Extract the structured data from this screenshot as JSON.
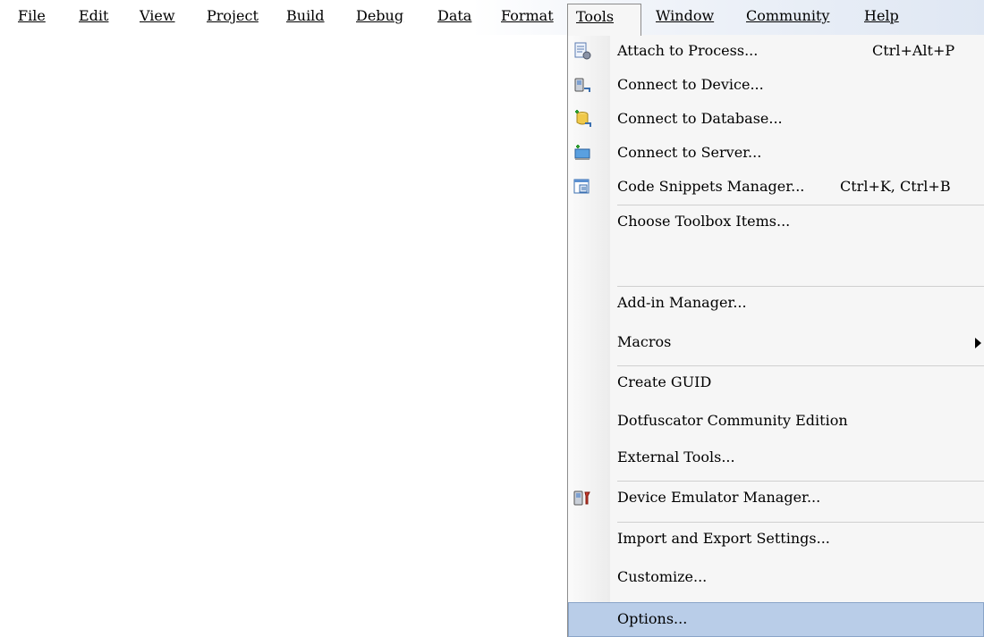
{
  "menubar": {
    "items": [
      {
        "label": "File"
      },
      {
        "label": "Edit"
      },
      {
        "label": "View"
      },
      {
        "label": "Project"
      },
      {
        "label": "Build"
      },
      {
        "label": "Debug"
      },
      {
        "label": "Data"
      },
      {
        "label": "Format"
      },
      {
        "label": "Tools"
      },
      {
        "label": "Window"
      },
      {
        "label": "Community"
      },
      {
        "label": "Help"
      }
    ]
  },
  "tools_menu": {
    "items": [
      {
        "label": "Attach to Process...",
        "shortcut": "Ctrl+Alt+P",
        "icon": "attach-process-icon"
      },
      {
        "label": "Connect to Device...",
        "icon": "connect-device-icon"
      },
      {
        "label": "Connect to Database...",
        "icon": "connect-database-icon"
      },
      {
        "label": "Connect to Server...",
        "icon": "connect-server-icon"
      },
      {
        "label": "Code Snippets Manager...",
        "shortcut": "Ctrl+K, Ctrl+B",
        "icon": "code-snippets-icon"
      },
      {
        "label": "Choose Toolbox Items..."
      },
      {
        "label": "Add-in Manager..."
      },
      {
        "label": "Macros",
        "submenu": true
      },
      {
        "label": "Create GUID"
      },
      {
        "label": "Dotfuscator Community Edition"
      },
      {
        "label": "External Tools..."
      },
      {
        "label": "Device Emulator Manager...",
        "icon": "device-emulator-icon"
      },
      {
        "label": "Import and Export Settings..."
      },
      {
        "label": "Customize..."
      },
      {
        "label": "Options...",
        "highlighted": true
      }
    ]
  },
  "colors": {
    "menu_bg": "#f6f6f6",
    "highlight": "#b9cde8",
    "highlight_border": "#8aa4c8"
  }
}
